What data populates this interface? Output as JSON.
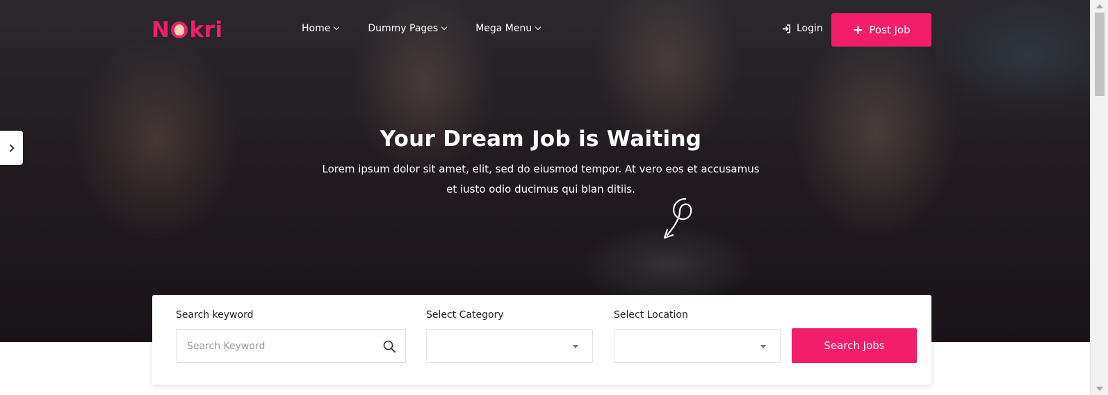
{
  "brand": {
    "logo_text_left": "N",
    "logo_text_right": "kri",
    "accent_color": "#f21e6a"
  },
  "nav": {
    "items": [
      {
        "label": "Home"
      },
      {
        "label": "Dummy Pages"
      },
      {
        "label": "Mega Menu"
      }
    ],
    "login_label": "Login",
    "post_job_label": "Post Job"
  },
  "hero": {
    "title": "Your Dream Job is Waiting",
    "subtitle_line1": "Lorem ipsum dolor sit amet, elit, sed do eiusmod tempor. At vero eos et accusamus",
    "subtitle_line2": "et iusto odio ducimus qui blan ditiis."
  },
  "search": {
    "keyword_label": "Search keyword",
    "keyword_placeholder": "Search Keyword",
    "keyword_value": "",
    "category_label": "Select Category",
    "category_value": "",
    "location_label": "Select Location",
    "location_value": "",
    "button_label": "Search Jobs"
  },
  "icons": {
    "login": "sign-in-icon",
    "post_job": "plus-icon",
    "search": "search-icon",
    "side_tab": "chevron-right-icon",
    "dropdown": "caret-down-icon"
  }
}
